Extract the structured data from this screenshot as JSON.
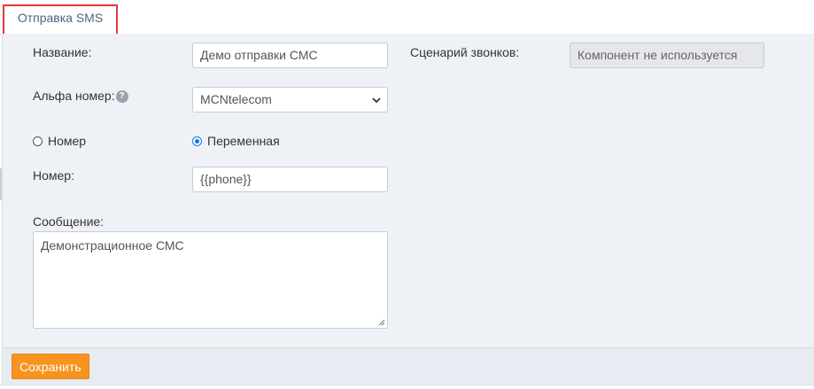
{
  "tabs": [
    {
      "label": "Отправка SMS",
      "active": true
    }
  ],
  "form": {
    "name_label": "Название:",
    "name_value": "Демо отправки СМС",
    "alpha_label": "Альфа номер:",
    "help_glyph": "?",
    "alpha_value": "MCNtelecom",
    "radio_number": "Номер",
    "radio_variable": "Переменная",
    "number_label": "Номер:",
    "number_value": "{{phone}}",
    "message_label": "Сообщение:",
    "message_value": "Демонстрационное СМС",
    "scenario_label": "Сценарий звонков:",
    "scenario_value": "Компонент не используется"
  },
  "footer": {
    "save_label": "Сохранить"
  },
  "colors": {
    "accent": "#f7931e",
    "tab_highlight": "#e03a3a",
    "radio_selected": "#1a73e8"
  },
  "icons": {
    "select_arrow": "chevron-down-icon",
    "help": "help-icon",
    "resize": "resize-grip-icon"
  }
}
